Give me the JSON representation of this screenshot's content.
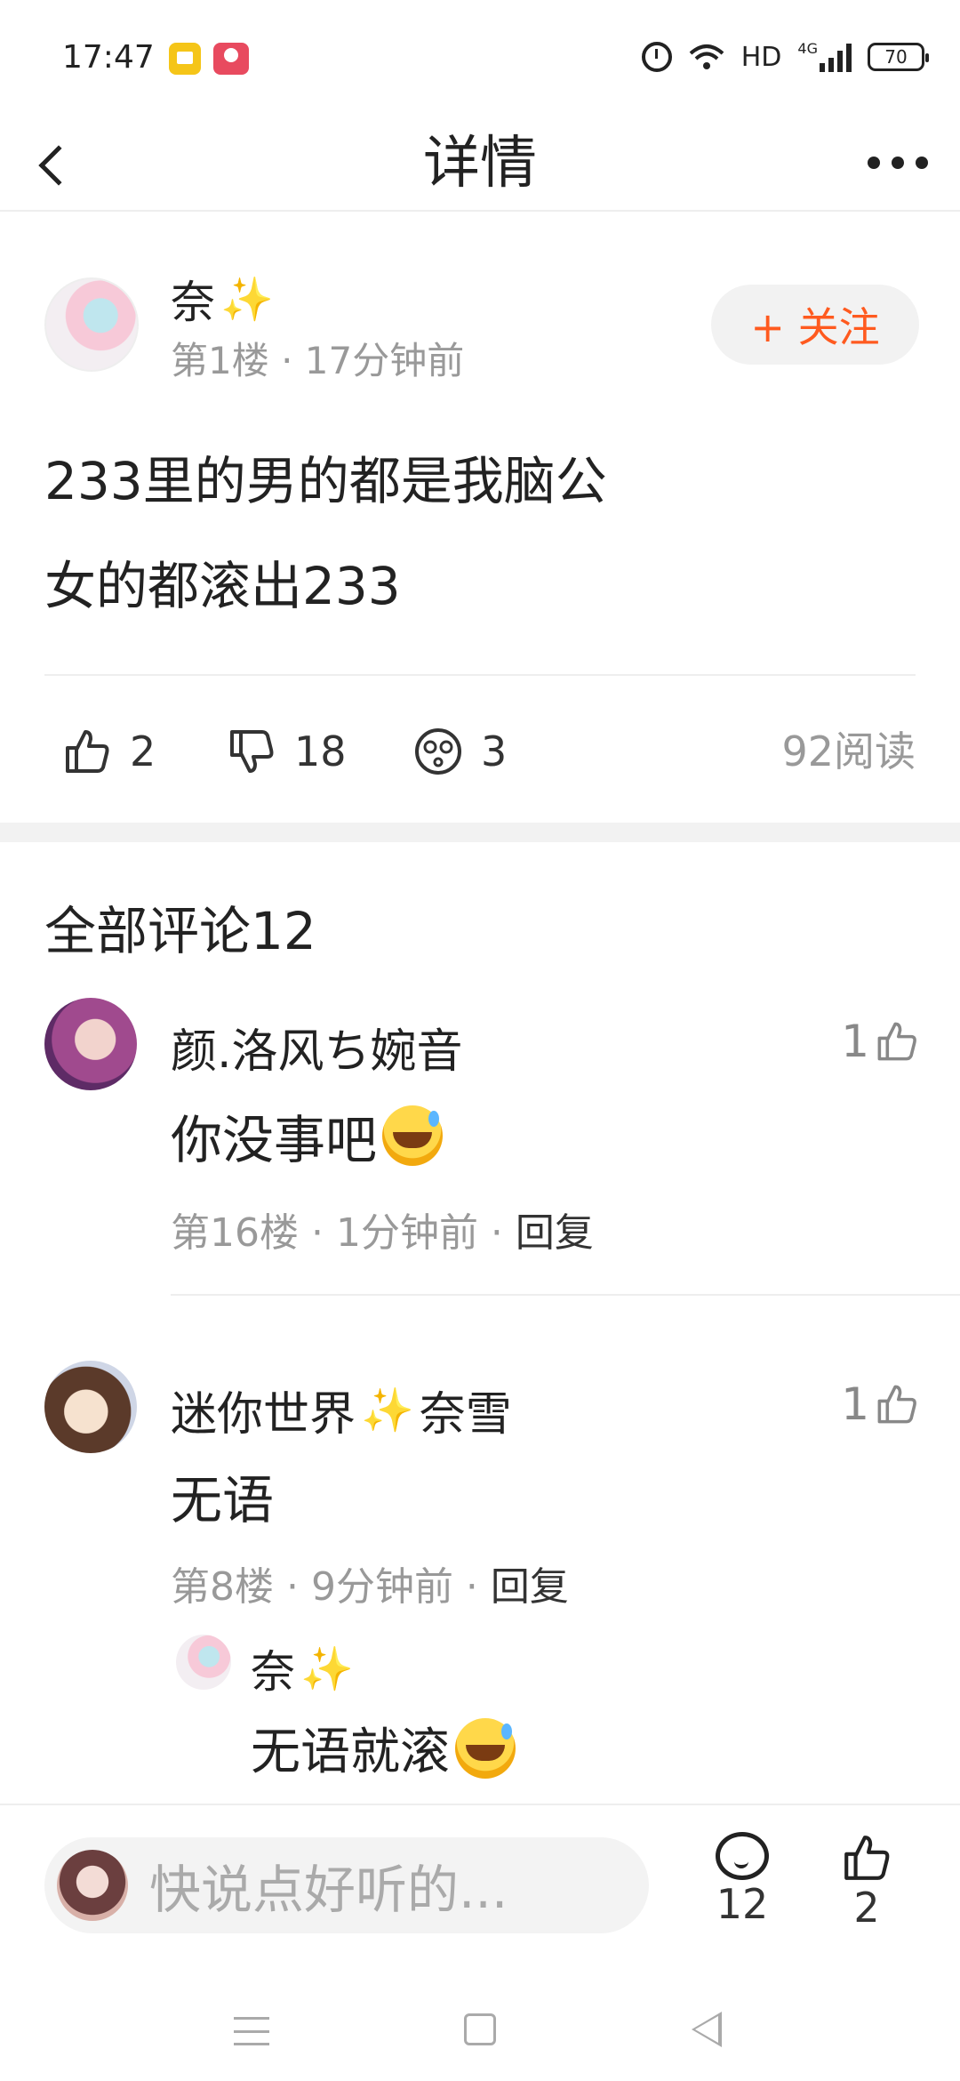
{
  "status_bar": {
    "time": "17:47",
    "network_label": "HD",
    "network_type": "4G",
    "battery": "70"
  },
  "header": {
    "title": "详情"
  },
  "post": {
    "author": "奈",
    "author_emoji": "✨",
    "meta": "第1楼 · 17分钟前",
    "follow_label": "+ 关注",
    "content_line1": "233里的男的都是我脑公",
    "content_line2": "女的都滚出233",
    "likes": "2",
    "dislikes": "18",
    "dizzy_count": "3",
    "reads": "92阅读"
  },
  "comments_section": {
    "title": "全部评论12"
  },
  "comments": [
    {
      "name": "颜.洛风ち婉音",
      "text": "你没事吧",
      "meta": "第16楼 · 1分钟前 · ",
      "reply_label": "回复",
      "likes": "1"
    },
    {
      "name_prefix": "迷你世界",
      "name_emoji": "✨",
      "name_suffix": "奈雪",
      "text": "无语",
      "meta": "第8楼 · 9分钟前 · ",
      "reply_label": "回复",
      "likes": "1",
      "sub_reply": {
        "name": "奈",
        "name_emoji": "✨",
        "text": "无语就滚"
      }
    }
  ],
  "bottom_bar": {
    "input_placeholder": "快说点好听的...",
    "comment_count": "12",
    "like_count": "2"
  },
  "colors": {
    "accent": "#ff5a1f",
    "muted_text": "#999999",
    "divider": "#eeeeee"
  },
  "icons": [
    "back-icon",
    "more-icon",
    "thumb-up-icon",
    "thumb-down-icon",
    "dizzy-face-icon",
    "sparkle-icon",
    "comment-icon",
    "emoji-sweat-smile-icon"
  ]
}
